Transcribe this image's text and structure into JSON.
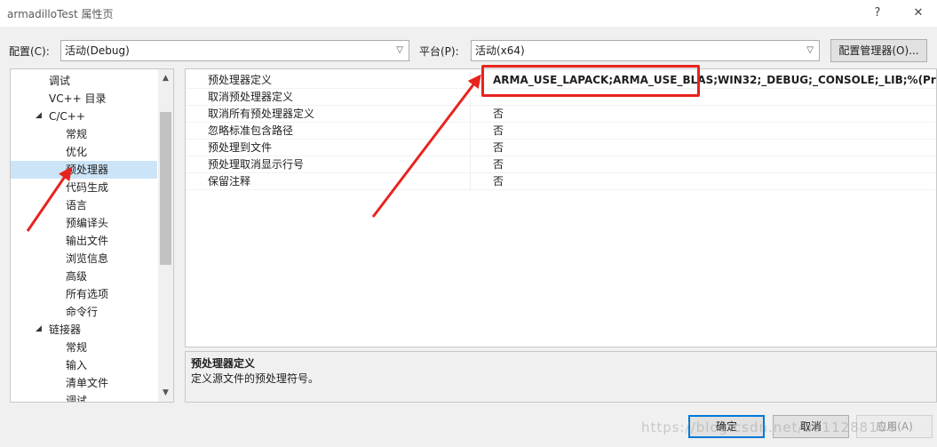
{
  "window": {
    "title": "armadilloTest 属性页",
    "help_label": "?",
    "close_label": "✕"
  },
  "config": {
    "label": "配置(C):",
    "value": "活动(Debug)",
    "platform_label": "平台(P):",
    "platform_value": "活动(x64)",
    "manager_button": "配置管理器(O)..."
  },
  "tree": {
    "items": [
      {
        "label": "调试",
        "indent": 1,
        "expand": ""
      },
      {
        "label": "VC++ 目录",
        "indent": 1,
        "expand": ""
      },
      {
        "label": "C/C++",
        "indent": 1,
        "expand": "◢"
      },
      {
        "label": "常规",
        "indent": 2,
        "expand": ""
      },
      {
        "label": "优化",
        "indent": 2,
        "expand": ""
      },
      {
        "label": "预处理器",
        "indent": 2,
        "expand": "",
        "selected": true
      },
      {
        "label": "代码生成",
        "indent": 2,
        "expand": ""
      },
      {
        "label": "语言",
        "indent": 2,
        "expand": ""
      },
      {
        "label": "预编译头",
        "indent": 2,
        "expand": ""
      },
      {
        "label": "输出文件",
        "indent": 2,
        "expand": ""
      },
      {
        "label": "浏览信息",
        "indent": 2,
        "expand": ""
      },
      {
        "label": "高级",
        "indent": 2,
        "expand": ""
      },
      {
        "label": "所有选项",
        "indent": 2,
        "expand": ""
      },
      {
        "label": "命令行",
        "indent": 2,
        "expand": ""
      },
      {
        "label": "链接器",
        "indent": 1,
        "expand": "◢"
      },
      {
        "label": "常规",
        "indent": 2,
        "expand": ""
      },
      {
        "label": "输入",
        "indent": 2,
        "expand": ""
      },
      {
        "label": "清单文件",
        "indent": 2,
        "expand": ""
      },
      {
        "label": "调试",
        "indent": 2,
        "expand": ""
      }
    ]
  },
  "properties": [
    {
      "name": "预处理器定义",
      "value": "ARMA_USE_LAPACK;ARMA_USE_BLAS;WIN32;_DEBUG;_CONSOLE;_LIB;%(PreprocessorDefinitions)",
      "bold": true
    },
    {
      "name": "取消预处理器定义",
      "value": ""
    },
    {
      "name": "取消所有预处理器定义",
      "value": "否"
    },
    {
      "name": "忽略标准包含路径",
      "value": "否"
    },
    {
      "name": "预处理到文件",
      "value": "否"
    },
    {
      "name": "预处理取消显示行号",
      "value": "否"
    },
    {
      "name": "保留注释",
      "value": "否"
    }
  ],
  "description": {
    "title": "预处理器定义",
    "text": "定义源文件的预处理符号。"
  },
  "buttons": {
    "ok": "确定",
    "cancel": "取消",
    "apply": "应用(A)"
  },
  "watermark": "https://blog.csdn.net/u011288106",
  "colors": {
    "annotation_red": "#e8231e",
    "selection": "#cce4f7",
    "accent": "#0078d7"
  }
}
